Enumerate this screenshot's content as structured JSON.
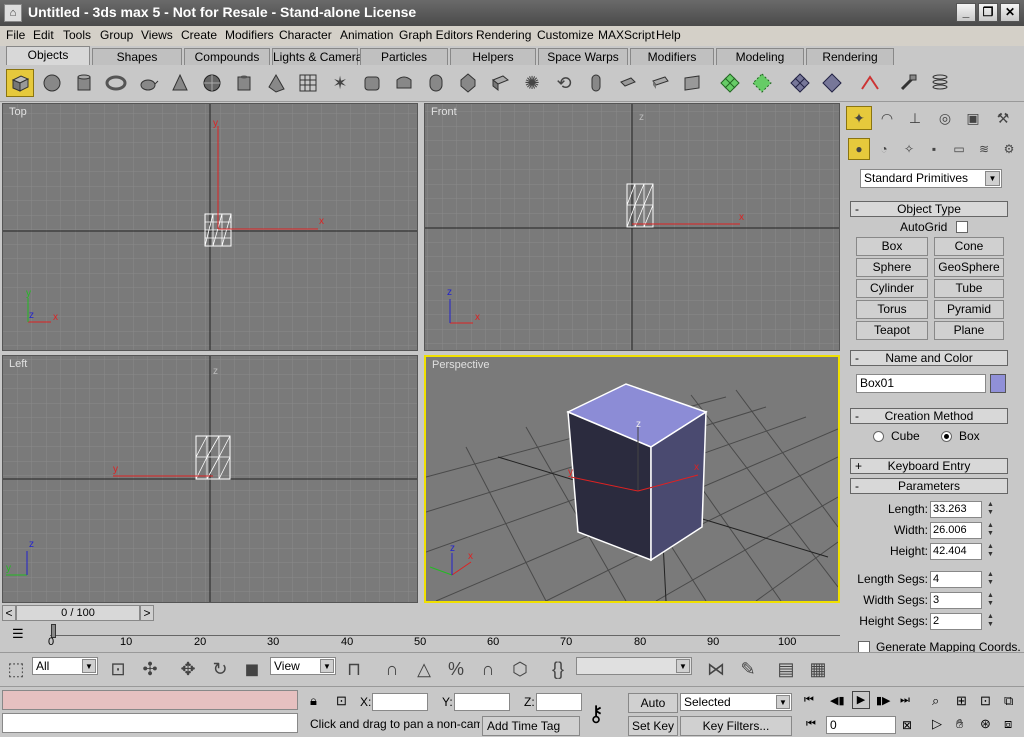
{
  "window": {
    "title": "Untitled - 3ds max 5 - Not for Resale - Stand-alone License",
    "app_icon": "max-icon",
    "minimize": "_",
    "maximize": "❐",
    "close": "✕"
  },
  "menu": [
    "File",
    "Edit",
    "Tools",
    "Group",
    "Views",
    "Create",
    "Modifiers",
    "Character",
    "Animation",
    "Graph Editors",
    "Rendering",
    "Customize",
    "MAXScript",
    "Help"
  ],
  "tabs": [
    "Objects",
    "Shapes",
    "Compounds",
    "Lights & Cameras",
    "Particles",
    "Helpers",
    "Space Warps",
    "Modifiers",
    "Modeling",
    "Rendering"
  ],
  "active_tab": "Objects",
  "viewports": {
    "top": "Top",
    "front": "Front",
    "left": "Left",
    "perspective": "Perspective"
  },
  "axis": {
    "x": "x",
    "y": "y",
    "z": "z"
  },
  "panel": {
    "dropdown": "Standard Primitives",
    "object_type": "Object Type",
    "autogrid": "AutoGrid",
    "buttons": [
      "Box",
      "Cone",
      "Sphere",
      "GeoSphere",
      "Cylinder",
      "Tube",
      "Torus",
      "Pyramid",
      "Teapot",
      "Plane"
    ],
    "name_and_color": "Name and Color",
    "object_name": "Box01",
    "object_color": "#9090d8",
    "creation_method": "Creation Method",
    "cube": "Cube",
    "box": "Box",
    "keyboard_entry": "Keyboard Entry",
    "parameters": "Parameters",
    "length_label": "Length:",
    "length": "33.263",
    "width_label": "Width:",
    "width": "26.006",
    "height_label": "Height:",
    "height": "42.404",
    "length_segs_label": "Length Segs:",
    "length_segs": "4",
    "width_segs_label": "Width Segs:",
    "width_segs": "3",
    "height_segs_label": "Height Segs:",
    "height_segs": "2",
    "gen_mapping": "Generate Mapping Coords.",
    "minus": "-",
    "plus": "+"
  },
  "timeline": {
    "frame": "0 / 100",
    "ticks": [
      "0",
      "10",
      "20",
      "30",
      "40",
      "50",
      "60",
      "70",
      "80",
      "90",
      "100"
    ],
    "prev": "<",
    "next": ">"
  },
  "bottom": {
    "filter": "All",
    "ref_coord": "View",
    "x_label": "X:",
    "y_label": "Y:",
    "z_label": "Z:",
    "auto_key": "Auto Key",
    "selected": "Selected",
    "set_key": "Set Key",
    "key_filters": "Key Filters...",
    "frame_value": "0",
    "status": "Click and drag to pan a non-camer",
    "add_time_tag": "Add Time Tag",
    "spinner_up": "▲",
    "spinner_down": "▼",
    "dropdown_arrow": "▼"
  }
}
